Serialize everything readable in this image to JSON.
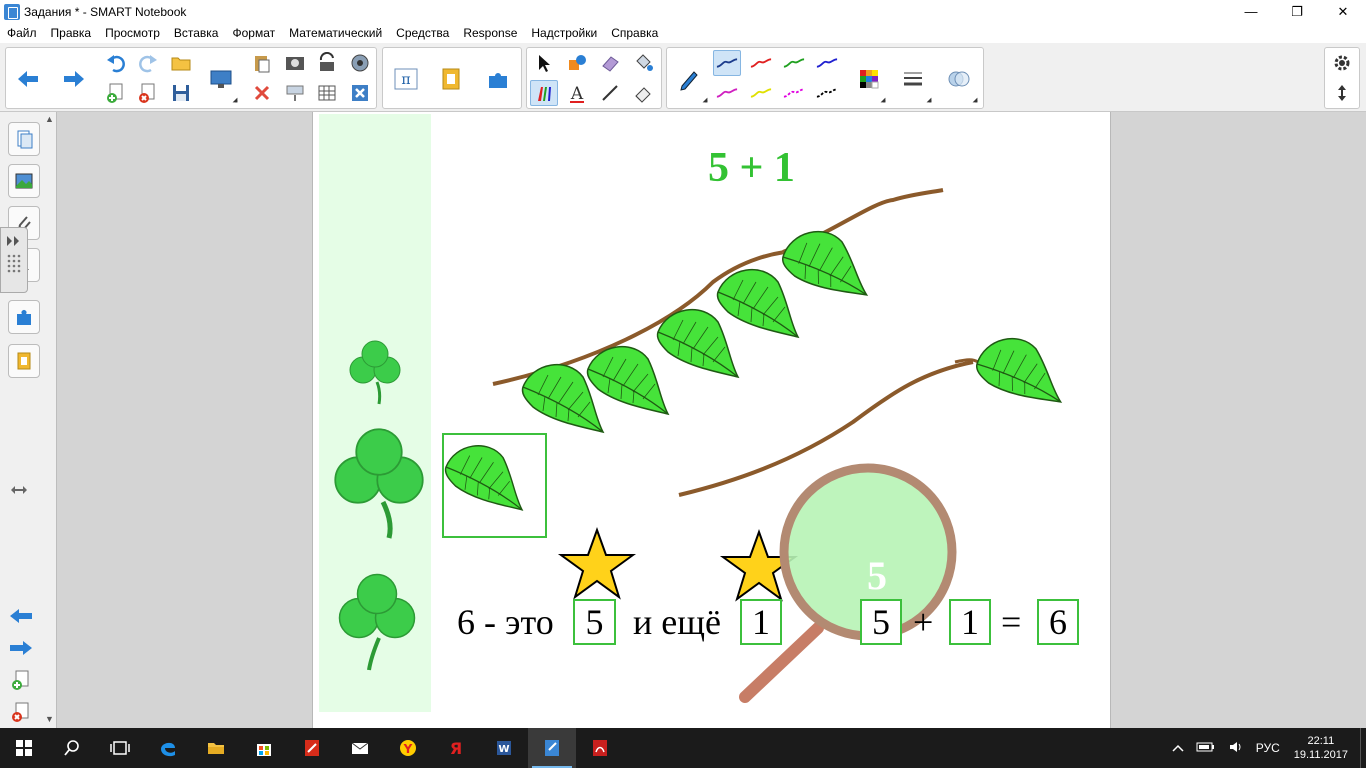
{
  "window": {
    "title": "Задания * - SMART Notebook",
    "minimize_glyph": "—",
    "restore_glyph": "❐",
    "close_glyph": "✕"
  },
  "menu": [
    "Файл",
    "Правка",
    "Просмотр",
    "Вставка",
    "Формат",
    "Математический",
    "Средства",
    "Response",
    "Надстройки",
    "Справка"
  ],
  "toolbar": {
    "navigation": [
      "back-arrow-icon",
      "forward-arrow-icon"
    ],
    "file": [
      "undo-icon",
      "redo-icon",
      "open-folder-icon",
      "add-page-icon",
      "delete-page-icon",
      "save-icon",
      "display-icon"
    ],
    "edit": [
      "paste-icon",
      "screen-capture-icon",
      "rotate-icon",
      "camera-icon",
      "delete-x-icon",
      "screen-shade-icon",
      "table-icon",
      "close-box-icon"
    ],
    "add_ons": [
      "math-pi-icon",
      "addon-icon",
      "puzzle-icon"
    ],
    "tools": [
      "select-arrow-icon",
      "shapes-icon",
      "eraser-block-icon",
      "fill-icon",
      "pens-icon",
      "text-icon",
      "line-icon",
      "eraser-icon"
    ],
    "pen_colors": [
      "#1c3c8c",
      "#e02020",
      "#20a020",
      "#2020d0",
      "#d020c0",
      "#e0e000",
      "#e000e0",
      "#000000"
    ],
    "accent": "#cfe4f7"
  },
  "canvas": {
    "title": "5 + 1",
    "phrase_part1": "6 - это",
    "box1": "5",
    "phrase_part2": "и ещё",
    "box2": "1",
    "sum_a": "5",
    "plus": "+",
    "sum_b": "1",
    "equals": "=",
    "result": "6",
    "magnifier_number": "5",
    "title_color": "#33c233",
    "leaf_color": "#3fdc2c",
    "star_color": "#ffd21a",
    "clover_color": "#3ccc4a"
  },
  "taskbar": {
    "apps": [
      "start-icon",
      "search-icon",
      "task-view-icon",
      "edge-icon",
      "explorer-icon",
      "store-icon",
      "smart-pdf-icon",
      "mail-icon",
      "yandex-browser-icon",
      "yandex-icon",
      "word-icon",
      "smart-notebook-icon",
      "acrobat-icon"
    ],
    "language": "РУС",
    "time": "22:11",
    "date": "19.11.2017"
  }
}
